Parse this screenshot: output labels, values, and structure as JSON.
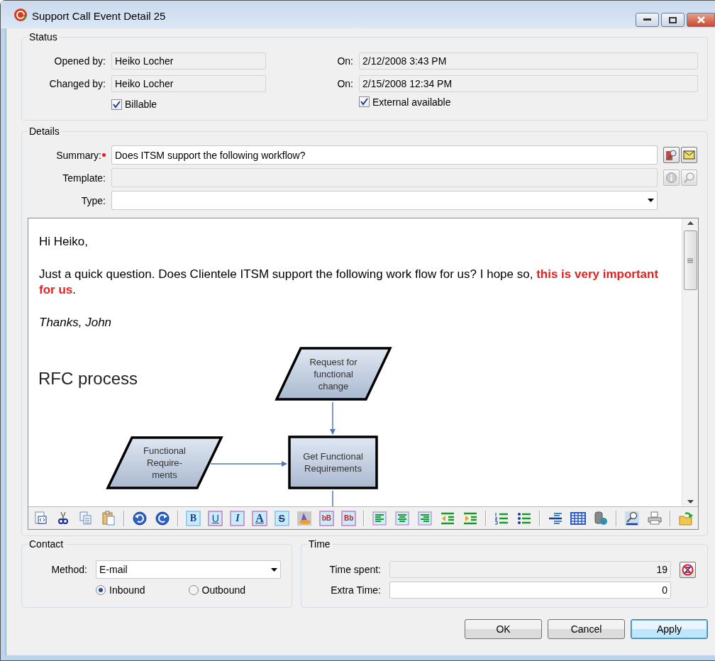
{
  "window": {
    "title": "Support Call Event Detail 25"
  },
  "status": {
    "title": "Status",
    "opened_by": {
      "label": "Opened by:",
      "value": "Heiko Locher",
      "disabled": true
    },
    "opened_on": {
      "label": "On:",
      "value": "2/12/2008 3:43 PM",
      "disabled": true
    },
    "changed_by": {
      "label": "Changed by:",
      "value": "Heiko Locher",
      "disabled": true
    },
    "changed_on": {
      "label": "On:",
      "value": "2/15/2008 12:34 PM",
      "disabled": true
    },
    "billable": {
      "label": "Billable",
      "checked": true
    },
    "external_available": {
      "label": "External available",
      "checked": true
    }
  },
  "details": {
    "title": "Details",
    "summary": {
      "label": "Summary:",
      "required": true,
      "value": "Does ITSM support the following workflow?",
      "disabled": false
    },
    "template": {
      "label": "Template:",
      "disabled": true
    },
    "type": {
      "label": "Type:",
      "disabled": false
    }
  },
  "editor": {
    "paragraphs": [
      {
        "kind": "plain",
        "text": "Hi Heiko,"
      },
      {
        "kind": "plain",
        "text": "Just a quick question. Does Clientele ITSM support the following work flow for us? I hope so, **this is very important for us**."
      },
      {
        "kind": "italic",
        "text": "Thanks, John"
      }
    ],
    "diagram": {
      "title": "RFC process",
      "nodes": [
        {
          "kind": "data",
          "lines": [
            "Request for",
            "functional",
            "change"
          ]
        },
        {
          "kind": "data",
          "lines": [
            "Functional",
            "Require-",
            "ments"
          ]
        },
        {
          "kind": "process",
          "lines": [
            "Get Functional",
            "Requirements"
          ]
        }
      ]
    },
    "toolbar": [
      {
        "kind": "source"
      },
      {
        "kind": "cut"
      },
      {
        "kind": "copy"
      },
      {
        "kind": "paste"
      },
      {
        "kind": "separator"
      },
      {
        "kind": "undo"
      },
      {
        "kind": "redo"
      },
      {
        "kind": "separator"
      },
      {
        "kind": "bold",
        "glyph": "B"
      },
      {
        "kind": "underline",
        "glyph": "U"
      },
      {
        "kind": "italic",
        "glyph": "I"
      },
      {
        "kind": "font",
        "glyph": "A"
      },
      {
        "kind": "strike",
        "glyph": "S"
      },
      {
        "kind": "color"
      },
      {
        "kind": "case",
        "glyph": "bB"
      },
      {
        "kind": "case",
        "glyph": "Bb"
      },
      {
        "kind": "separator"
      },
      {
        "kind": "align-left"
      },
      {
        "kind": "align-center"
      },
      {
        "kind": "align-right"
      },
      {
        "kind": "outdent"
      },
      {
        "kind": "indent"
      },
      {
        "kind": "separator"
      },
      {
        "kind": "numbered-list"
      },
      {
        "kind": "bulleted-list"
      },
      {
        "kind": "separator"
      },
      {
        "kind": "rule"
      },
      {
        "kind": "table"
      },
      {
        "kind": "database"
      },
      {
        "kind": "separator"
      },
      {
        "kind": "find-replace"
      },
      {
        "kind": "print"
      },
      {
        "kind": "separator"
      },
      {
        "kind": "open"
      }
    ]
  },
  "contact": {
    "title": "Contact",
    "method": {
      "label": "Method:",
      "value": "E-mail"
    },
    "directions": [
      {
        "label": "Inbound",
        "selected": true
      },
      {
        "label": "Outbound",
        "selected": false
      }
    ]
  },
  "time": {
    "title": "Time",
    "time_spent": {
      "label": "Time spent:",
      "value": "19",
      "disabled": true
    },
    "extra_time": {
      "label": "Extra Time:",
      "value": "0",
      "disabled": false
    }
  },
  "buttons": [
    {
      "label": "OK",
      "default": false
    },
    {
      "label": "Cancel",
      "default": false
    },
    {
      "label": "Apply",
      "default": true
    }
  ]
}
